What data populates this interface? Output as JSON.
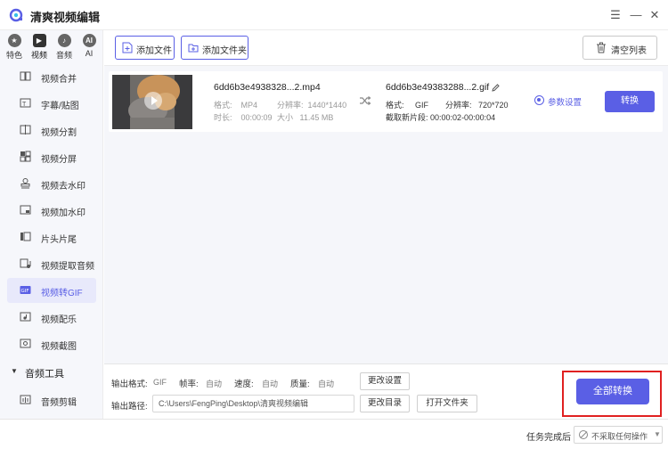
{
  "app": {
    "title": "清爽视频编辑"
  },
  "window": {
    "menu_icon": "menu-icon",
    "close_icon": "close-icon"
  },
  "sidebar": {
    "tabs": [
      {
        "label": "特色",
        "icon": "star-icon",
        "glyph": "★"
      },
      {
        "label": "视频",
        "icon": "video-icon",
        "glyph": "▶",
        "active": true
      },
      {
        "label": "音频",
        "icon": "music-icon",
        "glyph": "♪"
      },
      {
        "label": "AI",
        "icon": "ai-icon",
        "glyph": "AI"
      }
    ],
    "items": [
      {
        "label": "视频合并",
        "icon": "merge-icon"
      },
      {
        "label": "字幕/贴图",
        "icon": "subtitle-icon"
      },
      {
        "label": "视频分割",
        "icon": "split-icon"
      },
      {
        "label": "视频分屏",
        "icon": "split-screen-icon"
      },
      {
        "label": "视频去水印",
        "icon": "stamp-icon"
      },
      {
        "label": "视频加水印",
        "icon": "watermark-icon"
      },
      {
        "label": "片头片尾",
        "icon": "intro-outro-icon"
      },
      {
        "label": "视频提取音频",
        "icon": "extract-audio-icon"
      },
      {
        "label": "视频转GIF",
        "icon": "gif-icon",
        "active": true
      },
      {
        "label": "视频配乐",
        "icon": "soundtrack-icon"
      },
      {
        "label": "视频截图",
        "icon": "screenshot-icon"
      }
    ],
    "group": {
      "label": "音频工具"
    },
    "group_items": [
      {
        "label": "音频剪辑",
        "icon": "audio-cut-icon"
      }
    ]
  },
  "toolbar": {
    "add_file": "添加文件",
    "add_folder": "添加文件夹",
    "clear_list": "清空列表"
  },
  "file": {
    "source": {
      "name": "6dd6b3e4938328...2.mp4",
      "format_label": "格式:",
      "format": "MP4",
      "resolution_label": "分辨率:",
      "resolution": "1440*1440",
      "duration_label": "时长:",
      "duration": "00:00:09",
      "size_label": "大小",
      "size": "11.45 MB"
    },
    "output": {
      "name": "6dd6b3e49383288...2.gif",
      "format_label": "格式:",
      "format": "GIF",
      "resolution_label": "分辨率:",
      "resolution": "720*720",
      "clip_label": "截取新片段:",
      "clip": "00:00:02-00:00:04"
    },
    "params_label": "参数设置",
    "convert_label": "转换"
  },
  "bottom": {
    "output_format_label": "输出格式:",
    "output_format": "GIF",
    "frame_rate_label": "帧率:",
    "frame_rate": "自动",
    "speed_label": "速度:",
    "speed": "自动",
    "quality_label": "质量:",
    "quality": "自动",
    "change_settings": "更改设置",
    "output_path_label": "输出路径:",
    "output_path": "C:\\Users\\FengPing\\Desktop\\清爽视频编辑",
    "change_dir": "更改目录",
    "open_folder": "打开文件夹",
    "convert_all": "全部转换"
  },
  "status": {
    "after_task_label": "任务完成后",
    "after_task_value": "不采取任何操作"
  },
  "colors": {
    "accent": "#5a5fe5",
    "highlight": "#e02020"
  }
}
